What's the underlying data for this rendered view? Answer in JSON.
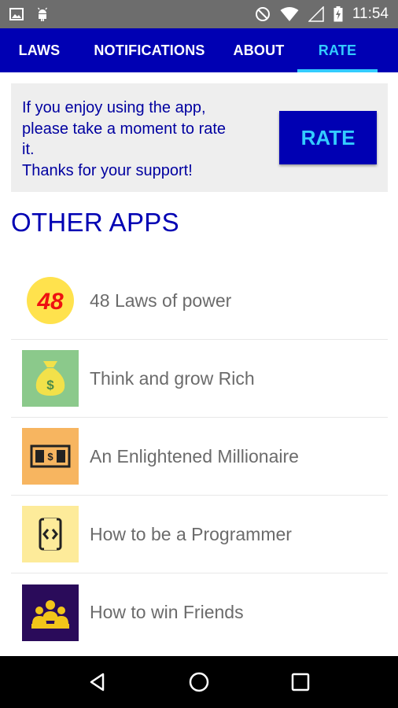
{
  "status_bar": {
    "time": "11:54",
    "left_icons": [
      "image-icon",
      "android-icon"
    ],
    "right_icons": [
      "do-not-disturb-icon",
      "wifi-icon",
      "cell-signal-icon",
      "battery-charging-icon"
    ]
  },
  "tabs": [
    {
      "label": "LAWS",
      "active": false
    },
    {
      "label": "NOTIFICATIONS",
      "active": false
    },
    {
      "label": "ABOUT",
      "active": false
    },
    {
      "label": "RATE",
      "active": true
    }
  ],
  "rate_card": {
    "lines": [
      "If you enjoy using the app,",
      "please take a moment to rate",
      "it.",
      "Thanks for your support!"
    ],
    "button_label": "RATE"
  },
  "other_apps": {
    "title": "OTHER APPS",
    "items": [
      {
        "label": "48 Laws of power",
        "icon": "48-laws-icon",
        "icon_text": "48"
      },
      {
        "label": "Think and grow Rich",
        "icon": "money-bag-icon"
      },
      {
        "label": "An Enlightened Millionaire",
        "icon": "banknote-icon"
      },
      {
        "label": "How to be a Programmer",
        "icon": "code-phone-icon"
      },
      {
        "label": "How to win Friends",
        "icon": "group-icon"
      }
    ]
  },
  "colors": {
    "primary": "#0000b3",
    "accent": "#33ccff",
    "status_bar": "#6d6d6d",
    "card_bg": "#eeeeee",
    "list_text": "#6b6b6b"
  }
}
